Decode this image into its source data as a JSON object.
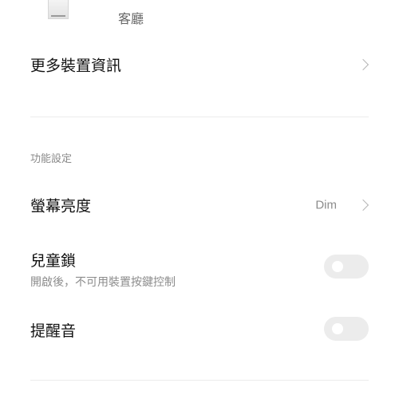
{
  "device": {
    "room": "客廳"
  },
  "more_info": {
    "label": "更多裝置資訊"
  },
  "section": {
    "title": "功能設定"
  },
  "settings": {
    "brightness": {
      "label": "螢幕亮度",
      "value": "Dim"
    },
    "child_lock": {
      "label": "兒童鎖",
      "sublabel": "開啟後，不可用裝置按鍵控制",
      "enabled": false
    },
    "beep": {
      "label": "提醒音",
      "enabled": false
    }
  },
  "icons": {
    "chevron": "chevron-right-icon",
    "device": "device-thumbnail"
  }
}
